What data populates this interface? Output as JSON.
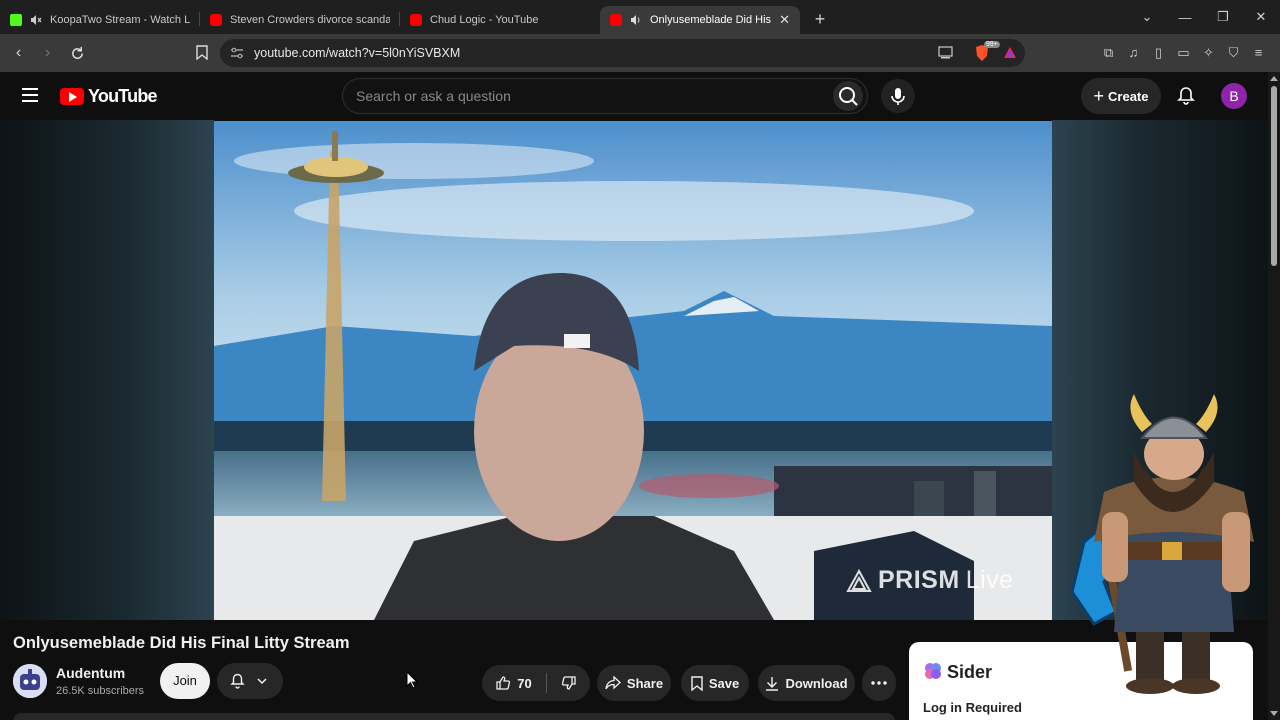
{
  "browser": {
    "tabs": [
      {
        "title": "KoopaTwo Stream - Watch Live o",
        "favicon_color": "#53fc18",
        "active": false,
        "muted": true
      },
      {
        "title": "Steven Crowders divorce scandal | RE",
        "favicon_color": "#ff0000",
        "active": false,
        "muted": false
      },
      {
        "title": "Chud Logic - YouTube",
        "favicon_color": "#ff0000",
        "active": false,
        "muted": false
      },
      {
        "title": "Onlyusemeblade Did His Fina",
        "favicon_color": "#ff0000",
        "active": true,
        "muted": true
      }
    ],
    "url": "youtube.com/watch?v=5l0nYiSVBXM",
    "brave_badge": "99+"
  },
  "youtube": {
    "logo_text": "YouTube",
    "search_placeholder": "Search or ask a question",
    "create_label": "Create",
    "avatar_letter": "B",
    "video": {
      "watermark_brand": "PRISM",
      "watermark_suffix": "Live",
      "title": "Onlyusemeblade Did His Final Litty Stream"
    },
    "channel": {
      "name": "Audentum",
      "subscribers": "26.5K subscribers",
      "join_label": "Join"
    },
    "actions": {
      "likes": "70",
      "share_label": "Share",
      "save_label": "Save",
      "download_label": "Download"
    }
  },
  "sider": {
    "name": "Sider",
    "status": "Log in Required"
  },
  "colors": {
    "yt_red": "#ff0000",
    "page_bg": "#0f0f0f",
    "avatar_purple": "#8e24aa"
  }
}
